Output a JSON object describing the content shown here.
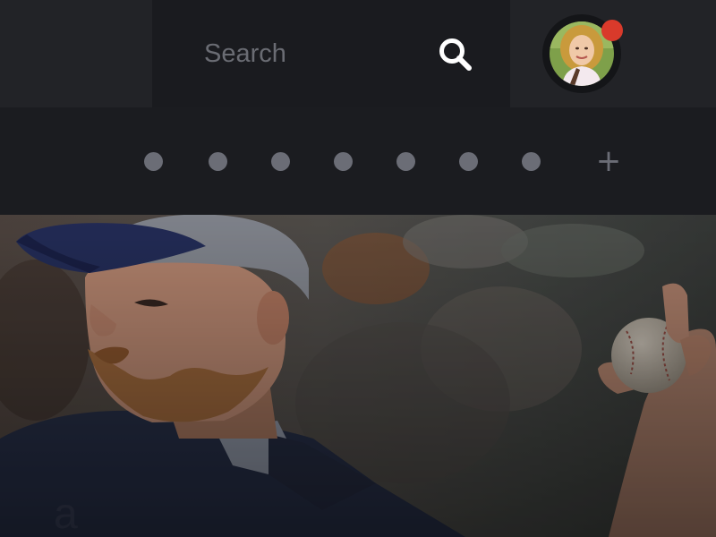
{
  "search": {
    "placeholder": "Search",
    "icon": "search-icon"
  },
  "profile": {
    "avatar_icon": "user-avatar",
    "notification_color": "#d93a2b"
  },
  "carousel": {
    "indicator_count": 7,
    "add_label": "+"
  },
  "hero": {
    "image": "baseball-pitcher-photo"
  },
  "colors": {
    "background": "#1b1c20",
    "panel": "#222327",
    "indicator": "#6b6d76",
    "accent": "#d93a2b"
  }
}
